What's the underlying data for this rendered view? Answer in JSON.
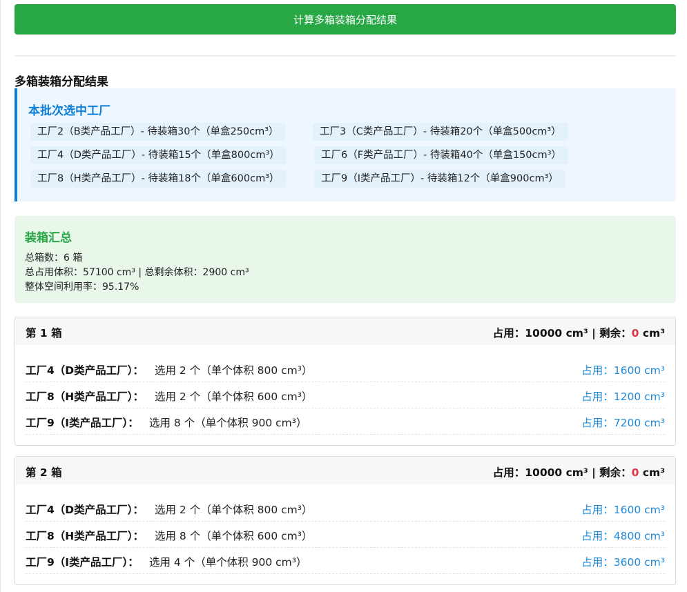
{
  "calculate_button": "计算多箱装箱分配结果",
  "result_title": "多箱装箱分配结果",
  "selected_factories": {
    "title": "本批次选中工厂",
    "items": [
      "工厂2（B类产品工厂）- 待装箱30个（单盒250cm³）",
      "工厂3（C类产品工厂）- 待装箱20个（单盒500cm³）",
      "工厂4（D类产品工厂）- 待装箱15个（单盒800cm³）",
      "工厂6（F类产品工厂）- 待装箱40个（单盒150cm³）",
      "工厂8（H类产品工厂）- 待装箱18个（单盒600cm³）",
      "工厂9（I类产品工厂）- 待装箱12个（单盒900cm³）"
    ]
  },
  "summary": {
    "title": "装箱汇总",
    "total_boxes": "总箱数：6 箱",
    "volume": "总占用体积：57100 cm³ | 总剩余体积：2900 cm³",
    "utilization": "整体空间利用率：95.17%"
  },
  "boxes": [
    {
      "name": "第 1 箱",
      "used_label": "占用：10000 cm³ | 剩余：",
      "remaining": "0",
      "unit": " cm³",
      "rows": [
        {
          "factory": "工厂4（D类产品工厂）：",
          "detail": "选用 2 个（单个体积 800 cm³）",
          "used": "占用：1600 cm³"
        },
        {
          "factory": "工厂8（H类产品工厂）：",
          "detail": "选用 2 个（单个体积 600 cm³）",
          "used": "占用：1200 cm³"
        },
        {
          "factory": "工厂9（I类产品工厂）：",
          "detail": "选用 8 个（单个体积 900 cm³）",
          "used": "占用：7200 cm³"
        }
      ]
    },
    {
      "name": "第 2 箱",
      "used_label": "占用：10000 cm³ | 剩余：",
      "remaining": "0",
      "unit": " cm³",
      "rows": [
        {
          "factory": "工厂4（D类产品工厂）：",
          "detail": "选用 2 个（单个体积 800 cm³）",
          "used": "占用：1600 cm³"
        },
        {
          "factory": "工厂8（H类产品工厂）：",
          "detail": "选用 8 个（单个体积 600 cm³）",
          "used": "占用：4800 cm³"
        },
        {
          "factory": "工厂9（I类产品工厂）：",
          "detail": "选用 4 个（单个体积 900 cm³）",
          "used": "占用：3600 cm³"
        }
      ]
    }
  ],
  "colors": {
    "button": "#28a745",
    "factory_accent": "#0d7fd6",
    "summary_accent": "#28a745",
    "remaining": "#dc3545",
    "used": "#1e88d6"
  }
}
